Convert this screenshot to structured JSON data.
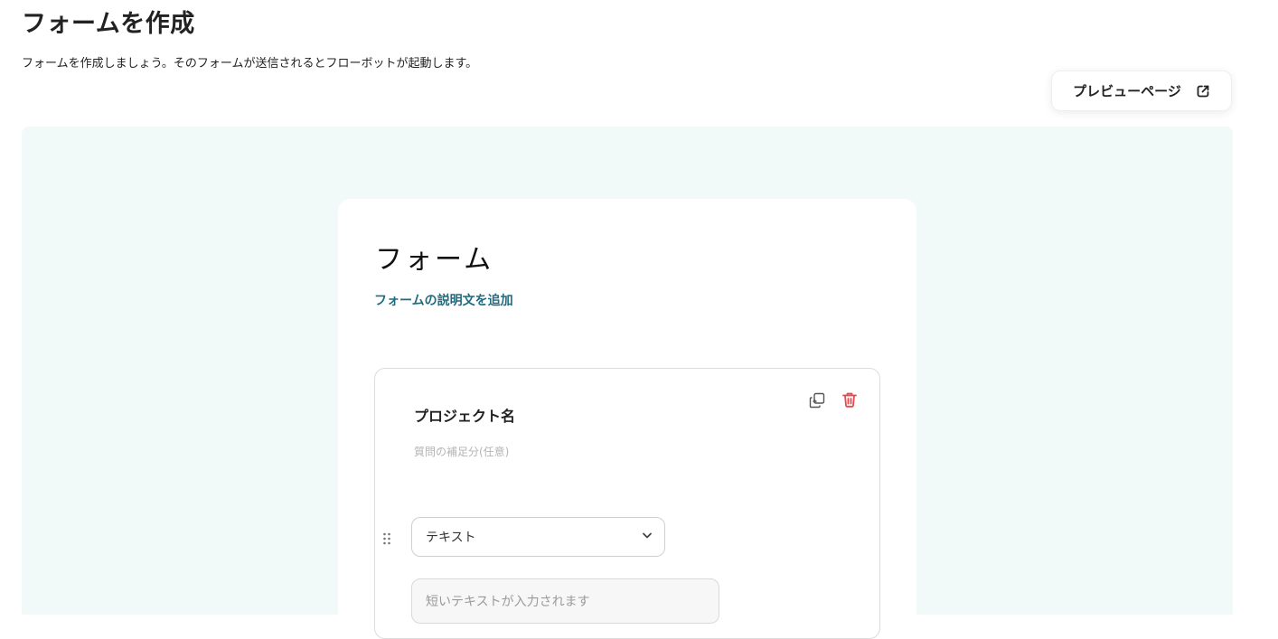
{
  "header": {
    "title": "フォームを作成",
    "description": "フォームを作成しましょう。そのフォームが送信されるとフローボットが起動します。",
    "preview_button_label": "プレビューページ",
    "preview_icon": "external-link-icon"
  },
  "form": {
    "title": "フォーム",
    "add_description_label": "フォームの説明文を追加",
    "questions": [
      {
        "title": "プロジェクト名",
        "help_placeholder": "質問の補足分(任意)",
        "type_label": "テキスト",
        "answer_placeholder": "短いテキストが入力されます",
        "icons": [
          "drag-handle-icon",
          "copy-icon",
          "trash-icon",
          "chevron-down-icon"
        ]
      }
    ]
  },
  "colors": {
    "canvas_bg": "#f1faf8",
    "link": "#1f6b7f",
    "delete": "#e5484d"
  }
}
